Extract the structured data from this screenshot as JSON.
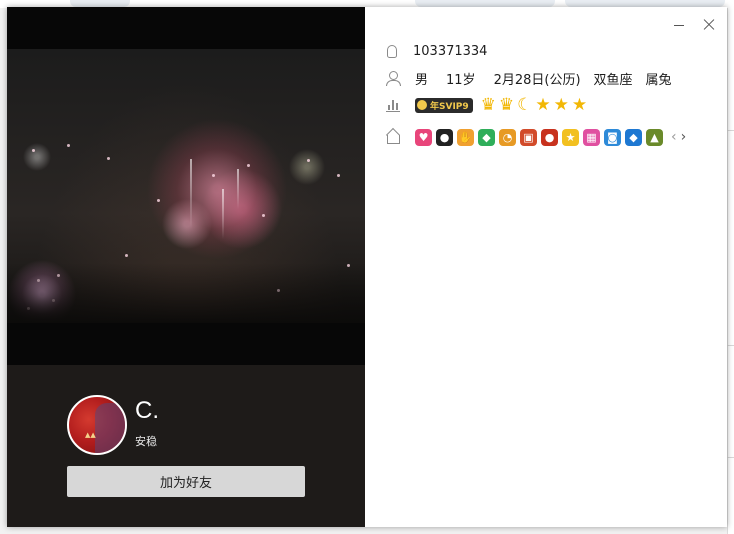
{
  "window": {
    "minimize_icon": "minimize-icon",
    "close_icon": "close-icon"
  },
  "profile": {
    "nickname": "C.",
    "signature": "安稳",
    "add_friend_label": "加为好友",
    "qq_number": "103371334",
    "gender": "男",
    "age": "11岁",
    "birthday": "2月28日(公历)",
    "constellation": "双鱼座",
    "zodiac": "属兔",
    "vip_badge": "年SVIP9",
    "level_icons": [
      "crown",
      "crown",
      "moon",
      "star",
      "star",
      "star"
    ],
    "service_icons": [
      {
        "name": "heart-service-icon",
        "glyph": "♥",
        "color": "#e8457a"
      },
      {
        "name": "penguin-service-icon",
        "glyph": "●",
        "color": "#222222"
      },
      {
        "name": "hand-service-icon",
        "glyph": "✋",
        "color": "#f0a030"
      },
      {
        "name": "diamond-service-icon",
        "glyph": "◆",
        "color": "#2fae5a"
      },
      {
        "name": "clock-service-icon",
        "glyph": "◔",
        "color": "#e79a25"
      },
      {
        "name": "game-service-icon",
        "glyph": "▣",
        "color": "#d24b2a"
      },
      {
        "name": "person-service-icon",
        "glyph": "●",
        "color": "#c8321e"
      },
      {
        "name": "star-service-icon",
        "glyph": "★",
        "color": "#f2c020"
      },
      {
        "name": "app-service-icon",
        "glyph": "▦",
        "color": "#e050a0"
      },
      {
        "name": "camera-service-icon",
        "glyph": "◙",
        "color": "#2d8ad8"
      },
      {
        "name": "cube-service-icon",
        "glyph": "◆",
        "color": "#1e78d2"
      },
      {
        "name": "plant-service-icon",
        "glyph": "▲",
        "color": "#6a8a2a"
      }
    ],
    "prev_arrow": "‹",
    "next_arrow": "›"
  },
  "colors": {
    "left_panel": "#1e1b19",
    "button_bg": "#d7d7d7",
    "crown_gold": "#f2b705"
  }
}
